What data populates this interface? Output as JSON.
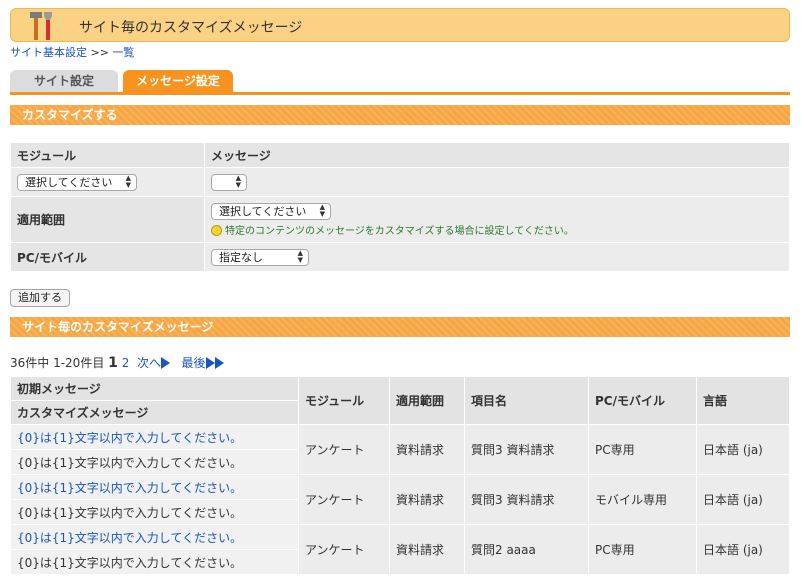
{
  "header": {
    "title": "サイト毎のカスタマイズメッセージ",
    "icon": "tools-icon"
  },
  "breadcrumb": {
    "item1": "サイト基本設定",
    "sep": ">>",
    "item2": "一覧"
  },
  "tabs": [
    {
      "label": "サイト設定",
      "active": false
    },
    {
      "label": "メッセージ設定",
      "active": true
    }
  ],
  "customize": {
    "section_title": "カスタマイズする",
    "module_label": "モジュール",
    "message_label": "メッセージ",
    "module_select": "選択してください",
    "message_select": "",
    "scope_label": "適用範囲",
    "scope_select": "選択してください",
    "scope_hint": "特定のコンテンツのメッセージをカスタマイズする場合に設定してください。",
    "device_label": "PC/モバイル",
    "device_select": "指定なし",
    "add_button": "追加する"
  },
  "list": {
    "section_title": "サイト毎のカスタマイズメッセージ",
    "pager": {
      "summary": "36件中 1-20件目",
      "current": "1",
      "page2": "2",
      "next": "次へ",
      "last": "最後"
    },
    "headers": {
      "initial": "初期メッセージ",
      "custom": "カスタマイズメッセージ",
      "module": "モジュール",
      "scope": "適用範囲",
      "item": "項目名",
      "device": "PC/モバイル",
      "lang": "言語"
    },
    "rows": [
      {
        "initial": "{0}は{1}文字以内で入力してください。",
        "custom": "{0}は{1}文字以内で入力してください。",
        "module": "アンケート",
        "scope": "資料請求",
        "item": "質問3 資料請求",
        "device": "PC専用",
        "lang": "日本語 (ja)"
      },
      {
        "initial": "{0}は{1}文字以内で入力してください。",
        "custom": "{0}は{1}文字以内で入力してください。",
        "module": "アンケート",
        "scope": "資料請求",
        "item": "質問3 資料請求",
        "device": "モバイル専用",
        "lang": "日本語 (ja)"
      },
      {
        "initial": "{0}は{1}文字以内で入力してください。",
        "custom": "{0}は{1}文字以内で入力してください。",
        "module": "アンケート",
        "scope": "資料請求",
        "item": "質問2 aaaa",
        "device": "PC専用",
        "lang": "日本語 (ja)"
      }
    ]
  },
  "colors": {
    "accent": "#f7931e",
    "header_bg": "#fbd183",
    "link": "#1a55c0"
  }
}
